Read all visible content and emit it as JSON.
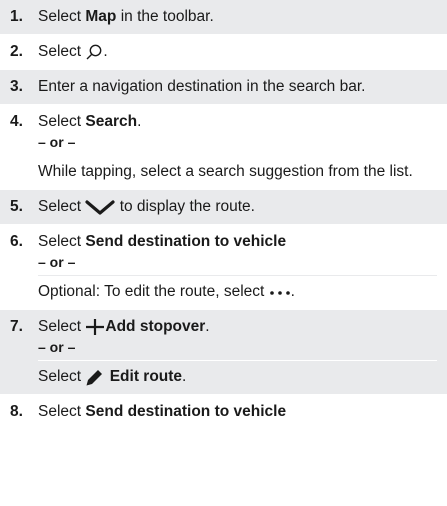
{
  "steps": [
    {
      "num": "1.",
      "pre": "Select ",
      "bold": "Map",
      "post": " in the toolbar."
    },
    {
      "num": "2.",
      "pre": "Select ",
      "icon": "search-icon",
      "post": "."
    },
    {
      "num": "3.",
      "text": "Enter a navigation destination in the search bar."
    },
    {
      "num": "4.",
      "pre": "Select ",
      "bold": "Search",
      "post": ".",
      "or": "– or –",
      "alt": "While tapping, select a search suggestion from the list."
    },
    {
      "num": "5.",
      "pre": "Select ",
      "icon": "chevron-down-icon",
      "post": " to display the route."
    },
    {
      "num": "6.",
      "pre": "Select ",
      "bold": "Send destination to vehicle",
      "or": "– or –",
      "alt_pre": "Optional: To edit the route, select ",
      "alt_icon": "more-dots-icon",
      "alt_post": "."
    },
    {
      "num": "7.",
      "pre": "Select ",
      "icon": "plus-icon",
      "bold": "Add stopover",
      "post": ".",
      "or": "– or –",
      "alt_pre": "Select ",
      "alt_icon": "pencil-icon",
      "alt_bold": "Edit route",
      "alt_post": "."
    },
    {
      "num": "8.",
      "pre": "Select ",
      "bold": "Send destination to vehicle"
    }
  ]
}
